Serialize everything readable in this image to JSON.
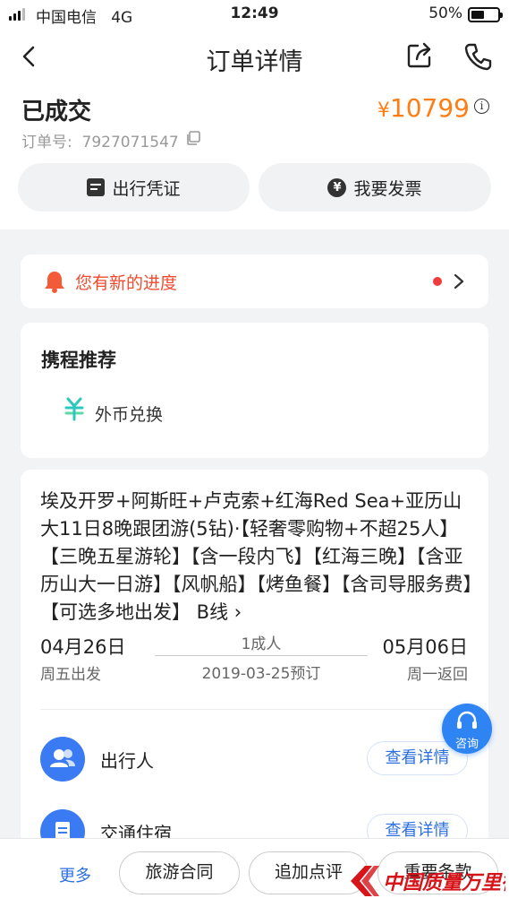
{
  "status_bar": {
    "carrier": "中国电信",
    "network": "4G",
    "time": "12:49",
    "battery": "50%",
    "battery_level": 0.5
  },
  "nav": {
    "title": "订单详情",
    "icons": [
      "back-icon",
      "share-icon",
      "phone-icon"
    ]
  },
  "order": {
    "status": "已成交",
    "currency_symbol": "¥",
    "price": "10799",
    "order_label": "订单号:",
    "order_number": "7927071547",
    "buttons": {
      "voucher": "出行凭证",
      "invoice": "我要发票"
    }
  },
  "progress": {
    "text": "您有新的进度"
  },
  "recommend": {
    "title": "携程推荐",
    "item_label": "外币兑换"
  },
  "trip": {
    "name": "埃及开罗+阿斯旺+卢克索+红海Red Sea+亚历山大11日8晚跟团游(5钻)·【轻奢零购物+不超25人】【三晚五星游轮】【含一段内飞】【红海三晚】【含亚历山大一日游】【风帆船】【烤鱼餐】【含司导服务费】【可选多地出发】 B线",
    "depart_date": "04月26日",
    "depart_week": "周五出发",
    "people": "1成人",
    "booked": "2019-03-25预订",
    "return_date": "05月06日",
    "return_week": "周一返回",
    "rows": [
      {
        "label": "出行人",
        "button": "查看详情"
      },
      {
        "label": "交通住宿",
        "button": "查看详情"
      }
    ]
  },
  "consult": {
    "label": "咨询"
  },
  "bottom_bar": {
    "more": "更多",
    "contract": "旅游合同",
    "review": "追加点评",
    "terms": "重要条款"
  },
  "watermark": {
    "text": "中国质量万里行"
  },
  "colors": {
    "accent": "#2c6fe0",
    "price": "#ff7d13",
    "alert": "#f04a2e"
  }
}
